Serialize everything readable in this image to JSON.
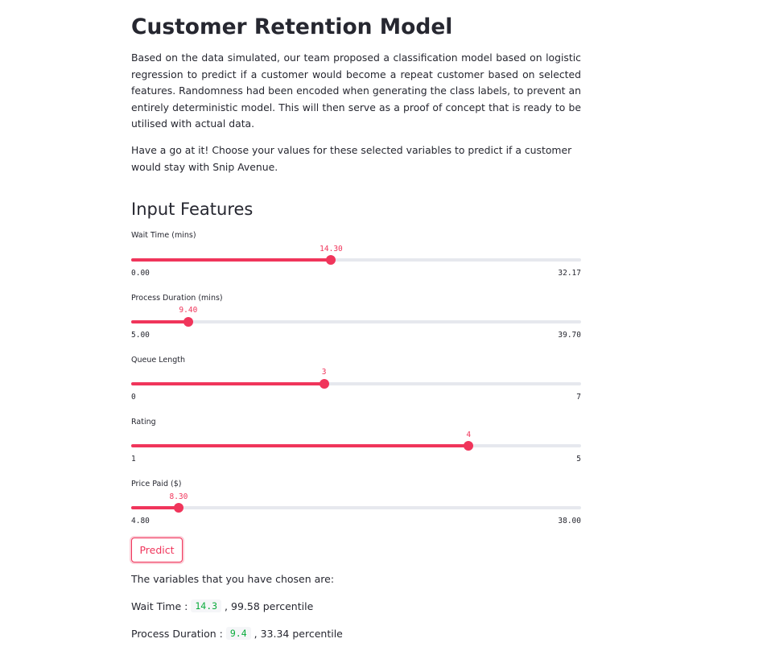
{
  "page": {
    "title": "Customer Retention Model",
    "intro_paragraph": "Based on the data simulated, our team proposed a classification model based on logistic regression to predict if a customer would become a repeat customer based on selected features. Randomness had been encoded when generating the class labels, to prevent an entirely deterministic model. This will then serve as a proof of concept that is ready to be utilised with actual data.",
    "instruction_paragraph": "Have a go at it! Choose your values for these selected variables to predict if a customer would stay with Snip Avenue."
  },
  "input_features": {
    "header": "Input Features",
    "sliders": [
      {
        "label": "Wait Time (mins)",
        "value": 14.3,
        "value_text": "14.30",
        "min": 0.0,
        "max": 32.17,
        "min_text": "0.00",
        "max_text": "32.17"
      },
      {
        "label": "Process Duration (mins)",
        "value": 9.4,
        "value_text": "9.40",
        "min": 5.0,
        "max": 39.7,
        "min_text": "5.00",
        "max_text": "39.70"
      },
      {
        "label": "Queue Length",
        "value": 3,
        "value_text": "3",
        "min": 0,
        "max": 7,
        "min_text": "0",
        "max_text": "7"
      },
      {
        "label": "Rating",
        "value": 4,
        "value_text": "4",
        "min": 1,
        "max": 5,
        "min_text": "1",
        "max_text": "5"
      },
      {
        "label": "Price Paid ($)",
        "value": 8.3,
        "value_text": "8.30",
        "min": 4.8,
        "max": 38.0,
        "min_text": "4.80",
        "max_text": "38.00"
      }
    ]
  },
  "predict_button": {
    "label": "Predict"
  },
  "results": {
    "intro": "The variables that you have chosen are:",
    "lines": [
      {
        "name": "Wait Time :",
        "value": "14.3",
        "suffix": ", 99.58 percentile"
      },
      {
        "name": "Process Duration :",
        "value": "9.4",
        "suffix": ", 33.34 percentile"
      }
    ]
  },
  "colors": {
    "accent": "#f0355b",
    "track": "#e6e8ee",
    "text": "#262730",
    "code_text": "#09ab3b",
    "code_bg": "#f5f6f8"
  }
}
